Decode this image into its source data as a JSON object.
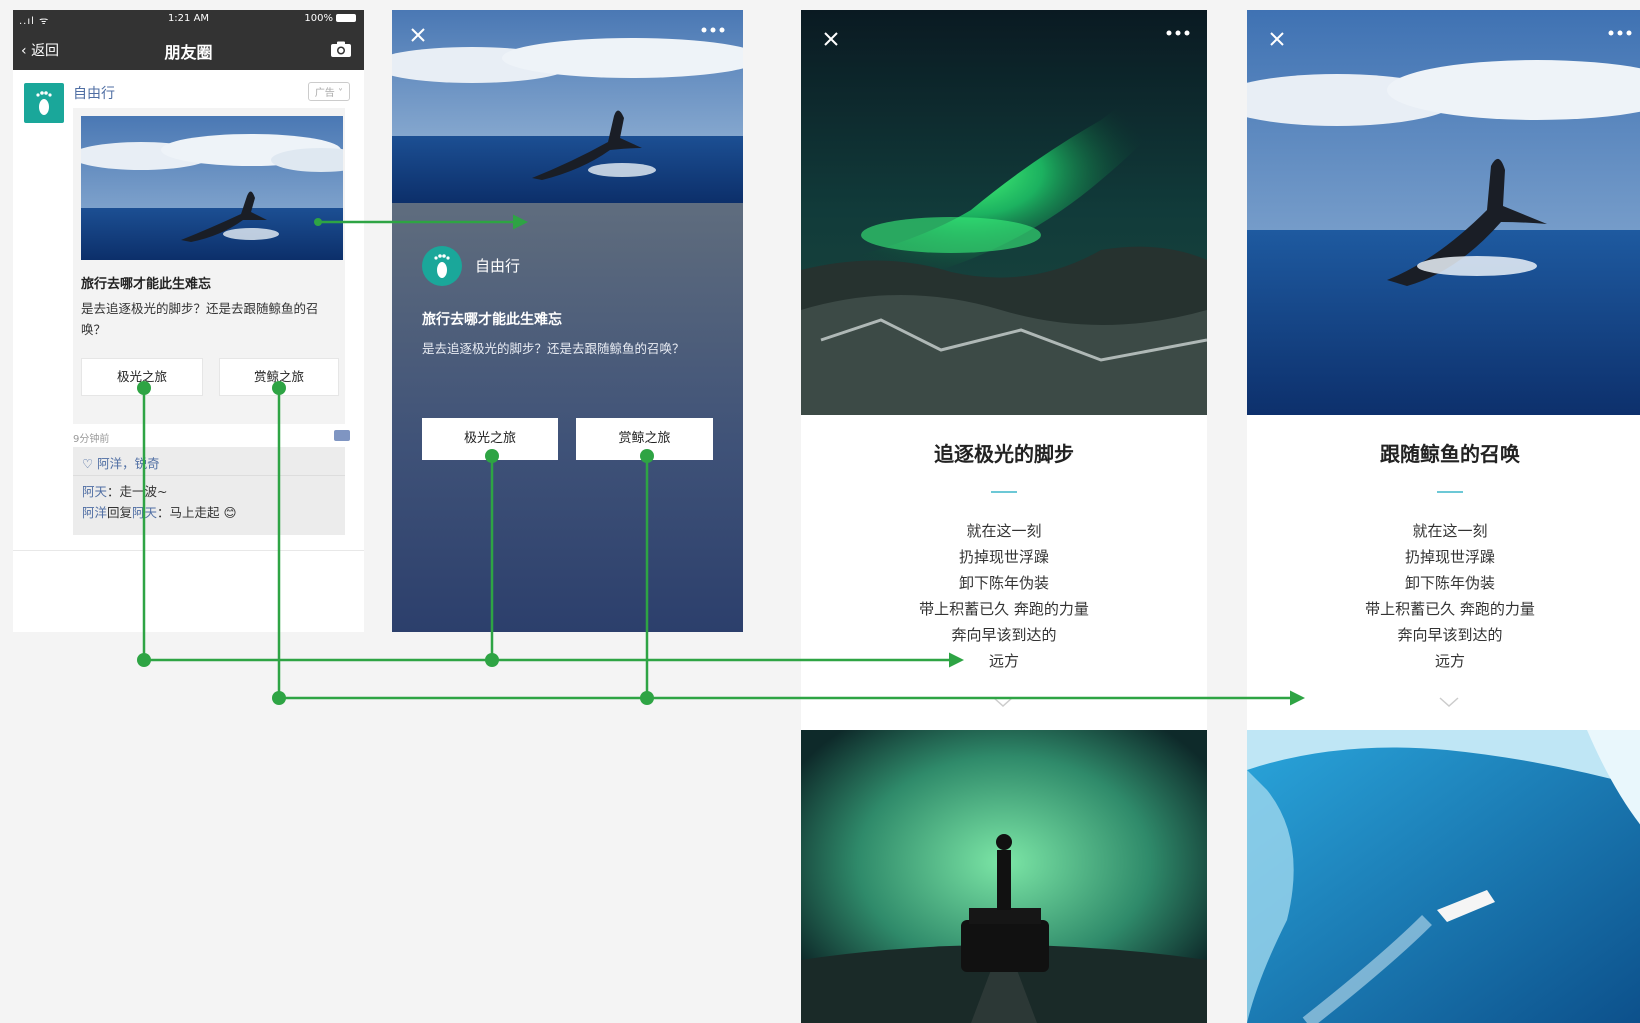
{
  "moments": {
    "status": {
      "signal": "..ıl ᯤ",
      "time": "1:21 AM",
      "battery": "100%"
    },
    "nav": {
      "back_label": "返回",
      "title": "朋友圈"
    },
    "ad": {
      "author": "自由行",
      "ad_tag": "广告 ˅",
      "title": "旅行去哪才能此生难忘",
      "desc": "是去追逐极光的脚步？还是去跟随鲸鱼的召唤？",
      "btn_aurora": "极光之旅",
      "btn_whale": "赏鲸之旅",
      "time_ago": "9分钟前"
    },
    "likes": "♡ 阿洋，锐奇",
    "comments": [
      {
        "name": "阿天",
        "text": "：走一波~"
      },
      {
        "name": "阿洋",
        "mid": "回复",
        "name2": "阿天",
        "text": "：马上走起 😊"
      }
    ]
  },
  "landing": {
    "author": "自由行",
    "title": "旅行去哪才能此生难忘",
    "desc": "是去追逐极光的脚步？还是去跟随鲸鱼的召唤？",
    "btn_aurora": "极光之旅",
    "btn_whale": "赏鲸之旅"
  },
  "aurora_page": {
    "title": "追逐极光的脚步",
    "lines": [
      "就在这一刻",
      "扔掉现世浮躁",
      "卸下陈年伪装",
      "带上积蓄已久 奔跑的力量",
      "奔向早该到达的",
      "远方"
    ]
  },
  "whale_page": {
    "title": "跟随鲸鱼的召唤",
    "lines": [
      "就在这一刻",
      "扔掉现世浮躁",
      "卸下陈年伪装",
      "带上积蓄已久 奔跑的力量",
      "奔向早该到达的",
      "远方"
    ]
  },
  "colors": {
    "accent": "#1aa79a",
    "flow_line": "#2ea444",
    "link_blue": "#4f6ea3",
    "divider": "#6cc8d6"
  }
}
